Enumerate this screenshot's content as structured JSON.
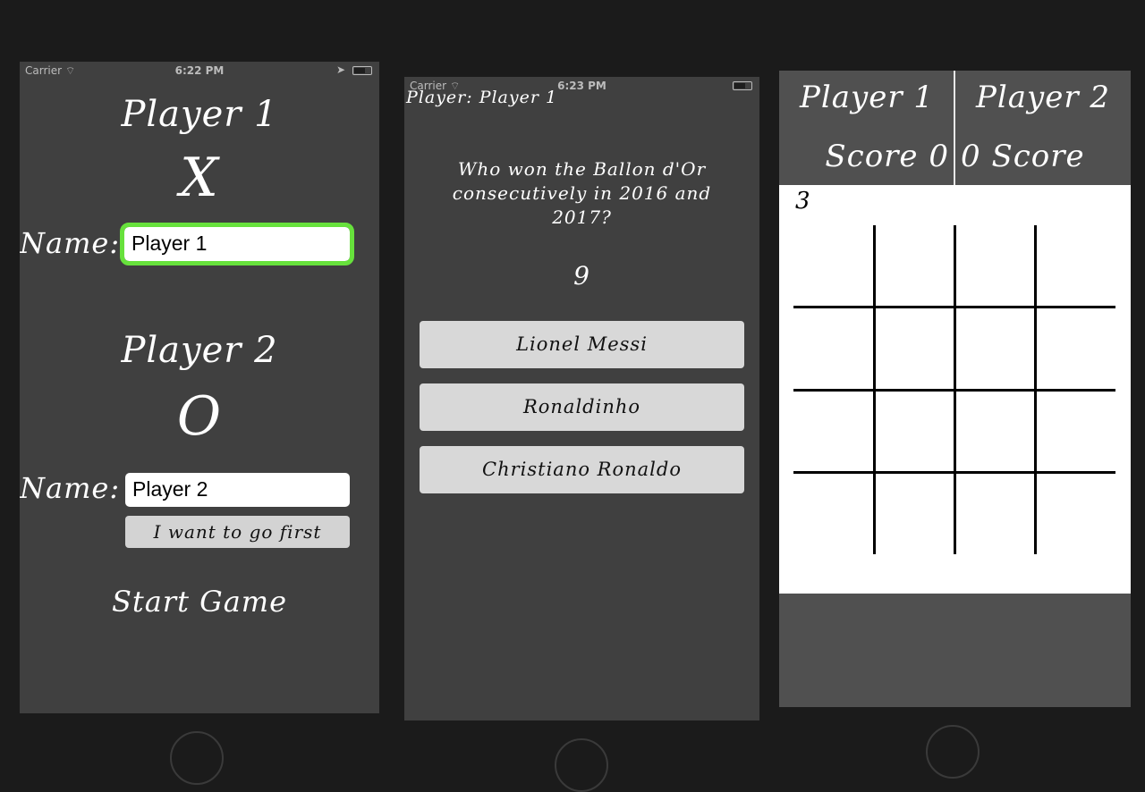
{
  "status": {
    "carrier": "Carrier",
    "screen1_time": "6:22 PM",
    "screen2_time": "6:23 PM"
  },
  "setup": {
    "player1_title": "Player 1",
    "player1_symbol": "X",
    "name_label": "Name:",
    "player1_name": "Player 1",
    "player2_title": "Player 2",
    "player2_symbol": "O",
    "player2_name": "Player 2",
    "go_first_label": "I want to go first",
    "start_label": "Start Game"
  },
  "quiz": {
    "player_line": "Player: Player 1",
    "question": "Who won the Ballon d'Or consecutively in 2016 and 2017?",
    "timer": "9",
    "answers": [
      "Lionel Messi",
      "Ronaldinho",
      "Christiano Ronaldo"
    ]
  },
  "game": {
    "player1_label": "Player 1",
    "player2_label": "Player 2",
    "score_label": "Score",
    "player1_score": "0",
    "player2_score": "0",
    "turn_indicator": "3"
  },
  "colors": {
    "focus_ring": "#67e13c",
    "screen_bg": "#404040"
  }
}
